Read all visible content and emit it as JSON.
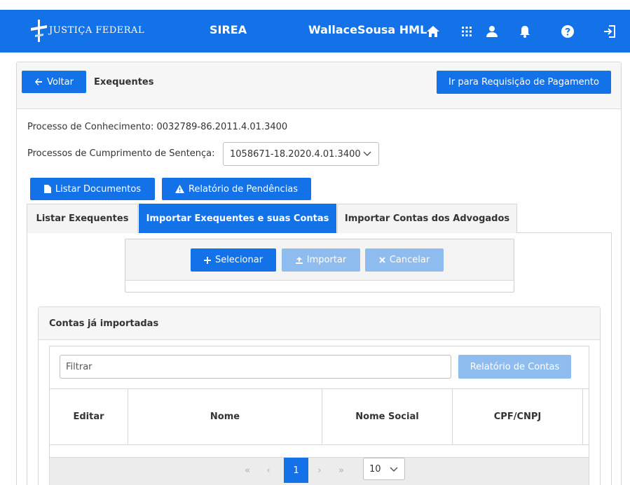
{
  "header": {
    "logo_text": "JUSTIÇA FEDERAL",
    "app_name": "SIREA",
    "user_name": "WallaceSousa HML"
  },
  "toolbar": {
    "back_label": "Voltar",
    "title": "Exequentes",
    "payment_request_label": "Ir para Requisição de Pagamento"
  },
  "process": {
    "knowledge_label": "Processo de Conhecimento: 0032789-86.2011.4.01.3400",
    "sentence_label": "Processos de Cumprimento de Sentença:",
    "sentence_selected": "1058671-18.2020.4.01.3400"
  },
  "actions": {
    "list_documents": "Listar Documentos",
    "pending_report": "Relatório de Pendências"
  },
  "tabs": [
    {
      "label": "Listar Exequentes"
    },
    {
      "label": "Importar Exequentes e suas Contas"
    },
    {
      "label": "Importar Contas dos Advogados"
    }
  ],
  "upload": {
    "select_label": "Selecionar",
    "import_label": "Importar",
    "cancel_label": "Cancelar"
  },
  "accounts": {
    "title": "Contas já importadas",
    "filter_placeholder": "Filtrar",
    "report_label": "Relatório de Contas",
    "columns": [
      "Editar",
      "Nome",
      "Nome Social",
      "CPF/CNPJ"
    ]
  },
  "pagination": {
    "first": "«",
    "prev": "‹",
    "current_page": "1",
    "next": "›",
    "last": "»",
    "page_size": "10"
  },
  "colors": {
    "primary": "#1472e8",
    "primary_disabled": "#8fbcef"
  }
}
